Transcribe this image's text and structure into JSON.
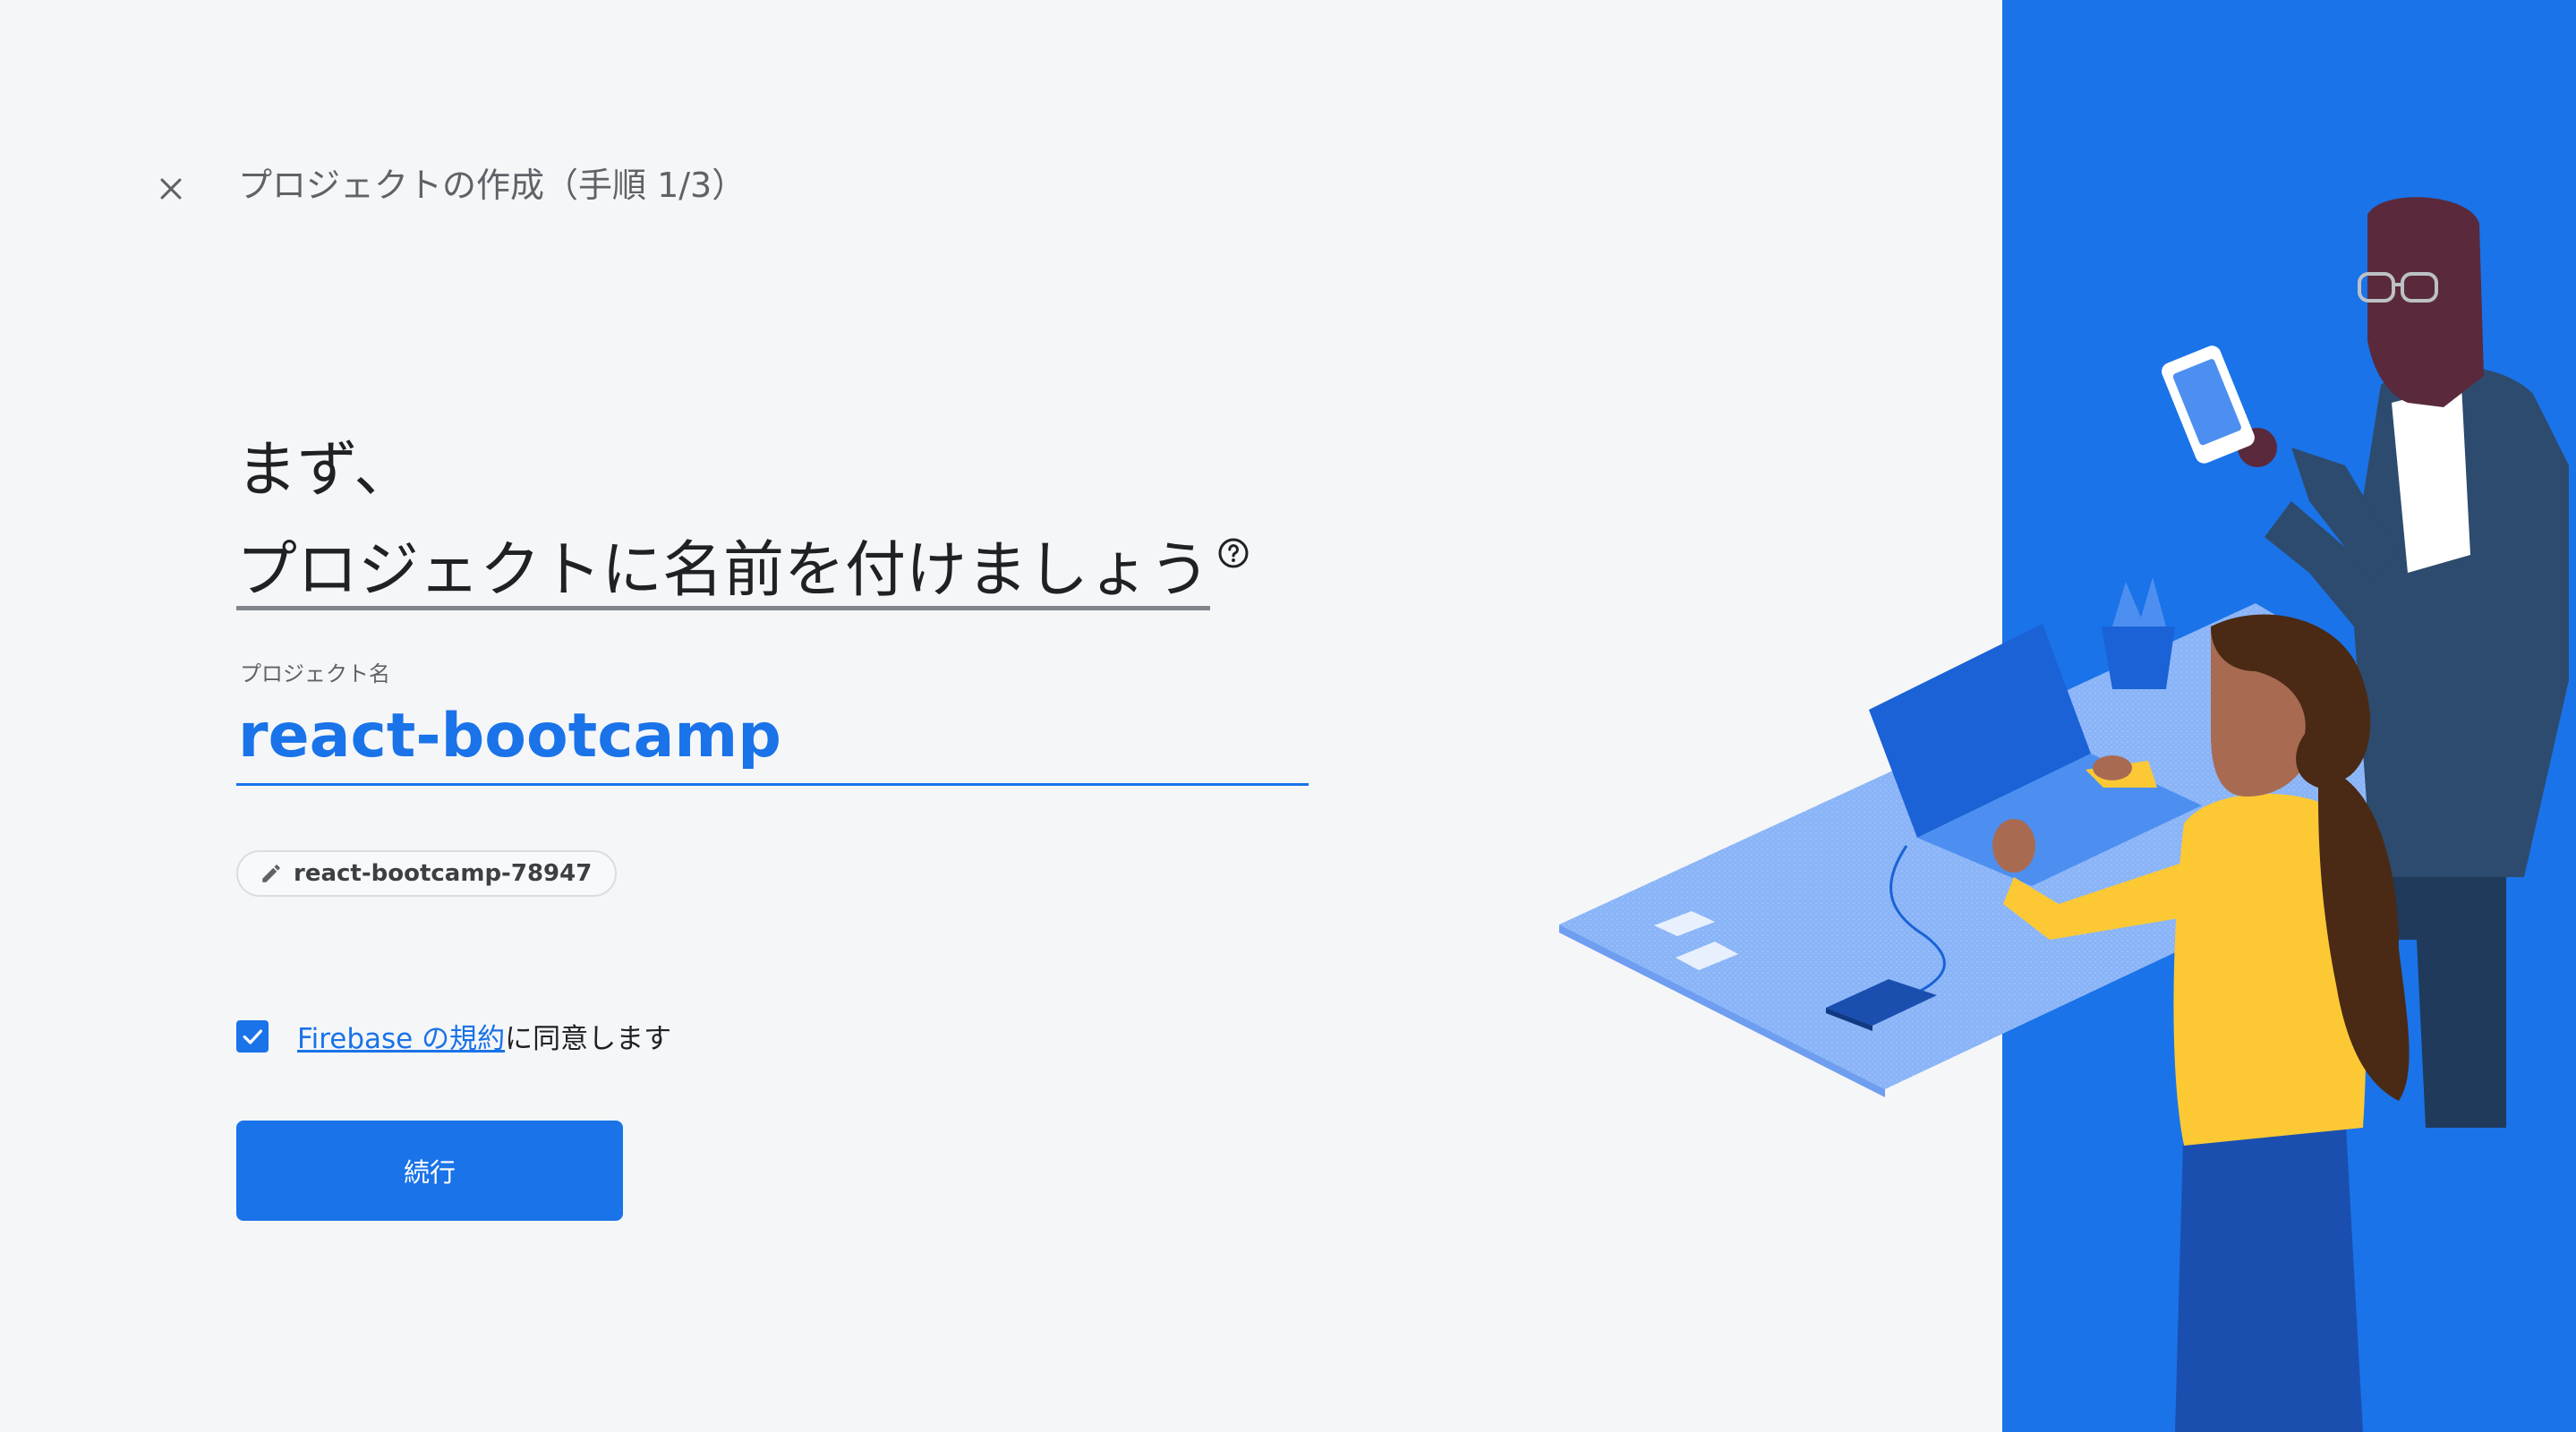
{
  "header": {
    "title": "プロジェクトの作成（手順 1/3）",
    "close_icon": "close-icon"
  },
  "heading": {
    "line1": "まず、",
    "line2": "プロジェクトに名前を付けましょう",
    "help_icon": "help-circle-icon"
  },
  "project_name": {
    "label": "プロジェクト名",
    "value": "react-bootcamp"
  },
  "project_id_chip": {
    "icon": "pencil-icon",
    "label": "react-bootcamp-78947"
  },
  "terms": {
    "checked": true,
    "link_text": "Firebase の規約",
    "suffix": "に同意します"
  },
  "continue_button": {
    "label": "続行"
  },
  "colors": {
    "accent": "#1a73e8",
    "panel": "#1a73e8",
    "background": "#f5f6f8"
  }
}
